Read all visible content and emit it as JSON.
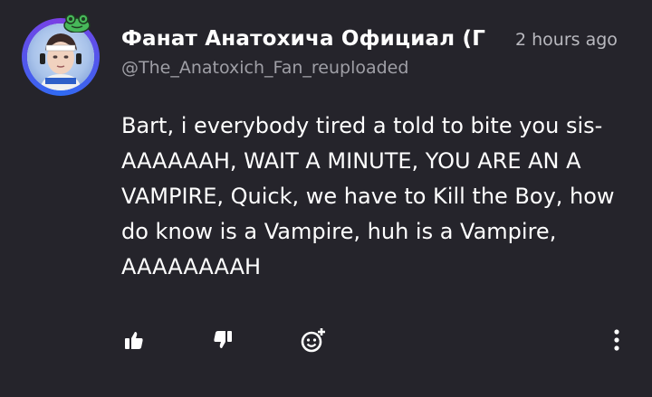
{
  "comment": {
    "author_name": "Фанат Анатохича Официал (Г",
    "timestamp": "2 hours ago",
    "handle": "@The_Anatoxich_Fan_reuploaded",
    "text": "Bart, i everybody tired a told to bite you sis- AAAAAAH, WAIT A MINUTE, YOU ARE AN A VAMPIRE, Quick, we have to Kill the Boy, how do know is a Vampire, huh is a Vampire, AAAAAAAAH"
  },
  "actions": {
    "like_icon": "thumbs-up-icon",
    "dislike_icon": "thumbs-down-icon",
    "react_icon": "add-emoji-icon",
    "more_icon": "more-vertical-icon"
  },
  "colors": {
    "background": "#25242b",
    "ring_start": "#7b3fe4",
    "ring_end": "#2f6bf2",
    "frog": "#47b85a"
  }
}
